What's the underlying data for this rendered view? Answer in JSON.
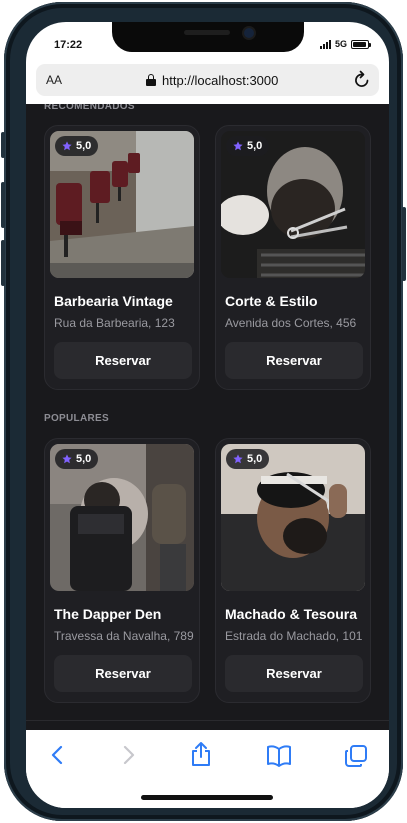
{
  "status_bar": {
    "time": "17:22",
    "network": "5G",
    "battery_level": 0.9
  },
  "browser": {
    "text_size_label": "AA",
    "url": "http://localhost:3000"
  },
  "sections": [
    {
      "title": "Recomendados",
      "cards": [
        {
          "rating": "5,0",
          "name": "Barbearia Vintage",
          "address": "Rua da Barbearia, 123",
          "button": "Reservar",
          "image": "barbershop-chairs-photo"
        },
        {
          "rating": "5,0",
          "name": "Corte & Estilo",
          "address": "Avenida dos Cortes, 456",
          "button": "Reservar",
          "image": "beard-trim-photo"
        }
      ]
    },
    {
      "title": "Populares",
      "cards": [
        {
          "rating": "5,0",
          "name": "The Dapper Den",
          "address": "Travessa da Navalha, 789",
          "button": "Reservar",
          "image": "haircut-in-chair-photo"
        },
        {
          "rating": "5,0",
          "name": "Machado & Tesoura",
          "address": "Estrada do Machado, 101",
          "button": "Reservar",
          "image": "comb-and-scissors-photo"
        }
      ]
    }
  ],
  "toolbar": [
    "back-icon",
    "forward-icon",
    "share-icon",
    "bookmarks-icon",
    "tabs-icon"
  ],
  "colors": {
    "accent_star": "#8162ff",
    "background": "#19191c",
    "card": "#1f1f23",
    "button": "#2a2a2e",
    "toolbar_icon": "#2f7cf6"
  }
}
